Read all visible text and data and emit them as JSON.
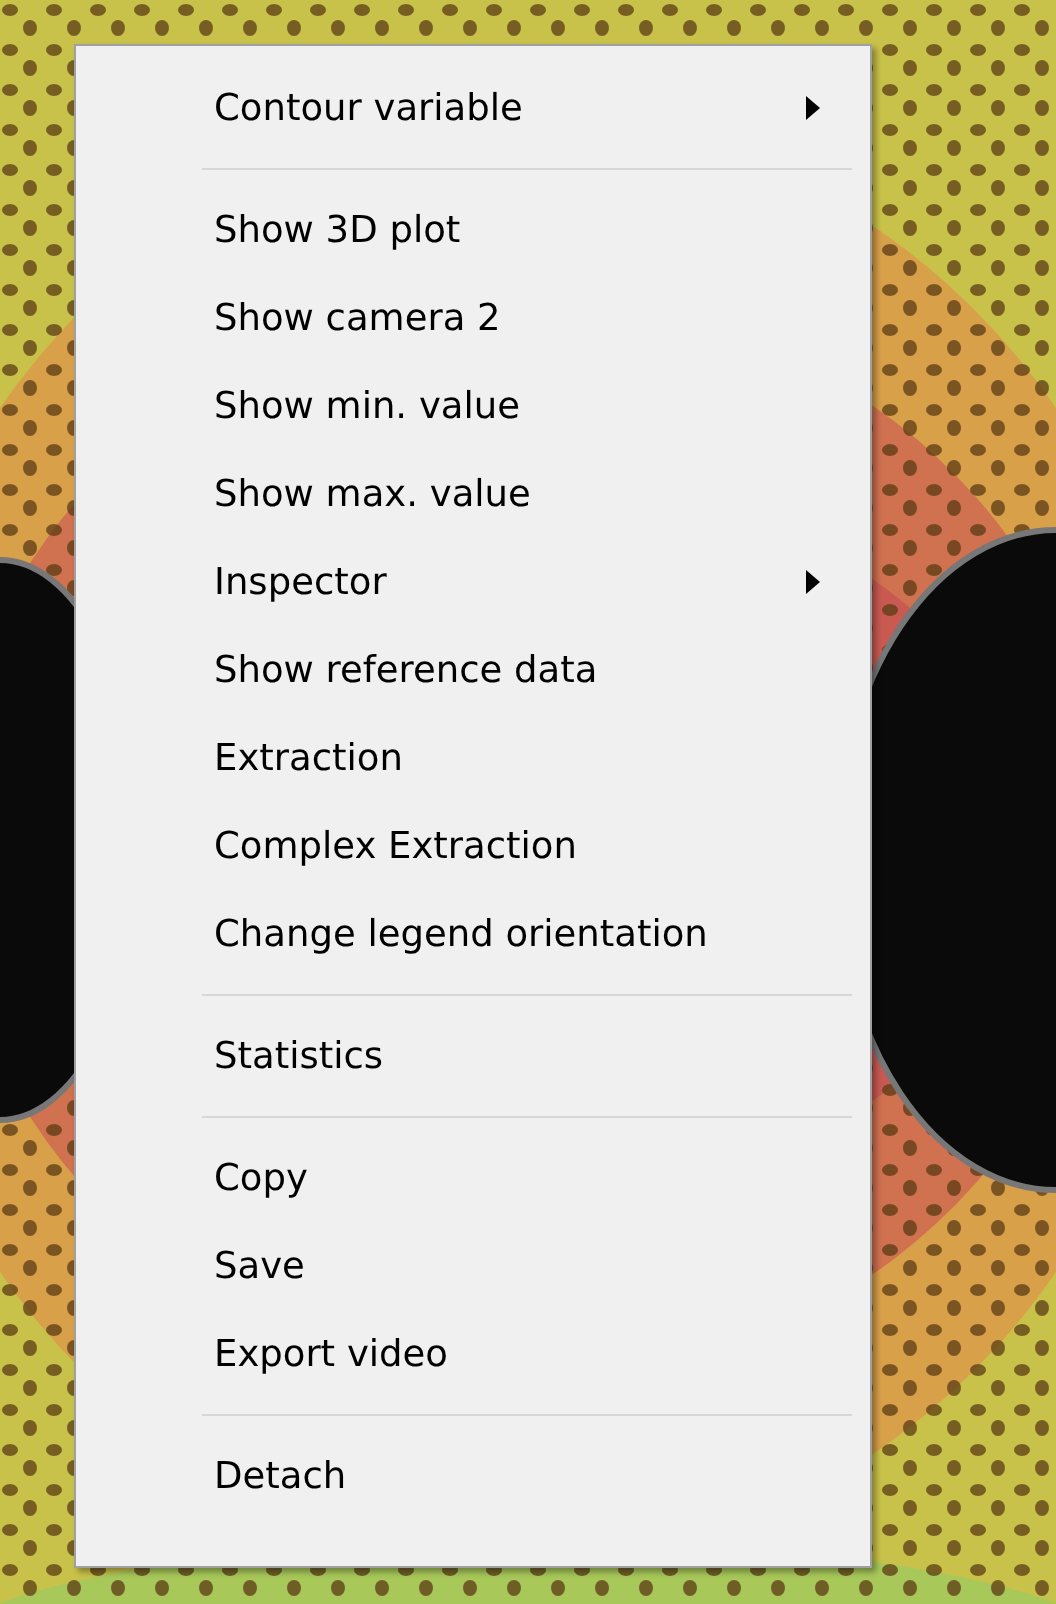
{
  "menu": {
    "items": [
      {
        "kind": "item",
        "label": "Contour variable",
        "submenu": true
      },
      {
        "kind": "separator"
      },
      {
        "kind": "item",
        "label": "Show 3D plot",
        "submenu": false
      },
      {
        "kind": "item",
        "label": "Show camera 2",
        "submenu": false
      },
      {
        "kind": "item",
        "label": "Show min. value",
        "submenu": false
      },
      {
        "kind": "item",
        "label": "Show max. value",
        "submenu": false
      },
      {
        "kind": "item",
        "label": "Inspector",
        "submenu": true
      },
      {
        "kind": "item",
        "label": "Show reference data",
        "submenu": false
      },
      {
        "kind": "item",
        "label": "Extraction",
        "submenu": false
      },
      {
        "kind": "item",
        "label": "Complex Extraction",
        "submenu": false
      },
      {
        "kind": "item",
        "label": "Change legend orientation",
        "submenu": false
      },
      {
        "kind": "separator"
      },
      {
        "kind": "item",
        "label": "Statistics",
        "submenu": false
      },
      {
        "kind": "separator"
      },
      {
        "kind": "item",
        "label": "Copy",
        "submenu": false
      },
      {
        "kind": "item",
        "label": "Save",
        "submenu": false
      },
      {
        "kind": "item",
        "label": "Export video",
        "submenu": false
      },
      {
        "kind": "separator"
      },
      {
        "kind": "item",
        "label": "Detach",
        "submenu": false
      }
    ]
  }
}
